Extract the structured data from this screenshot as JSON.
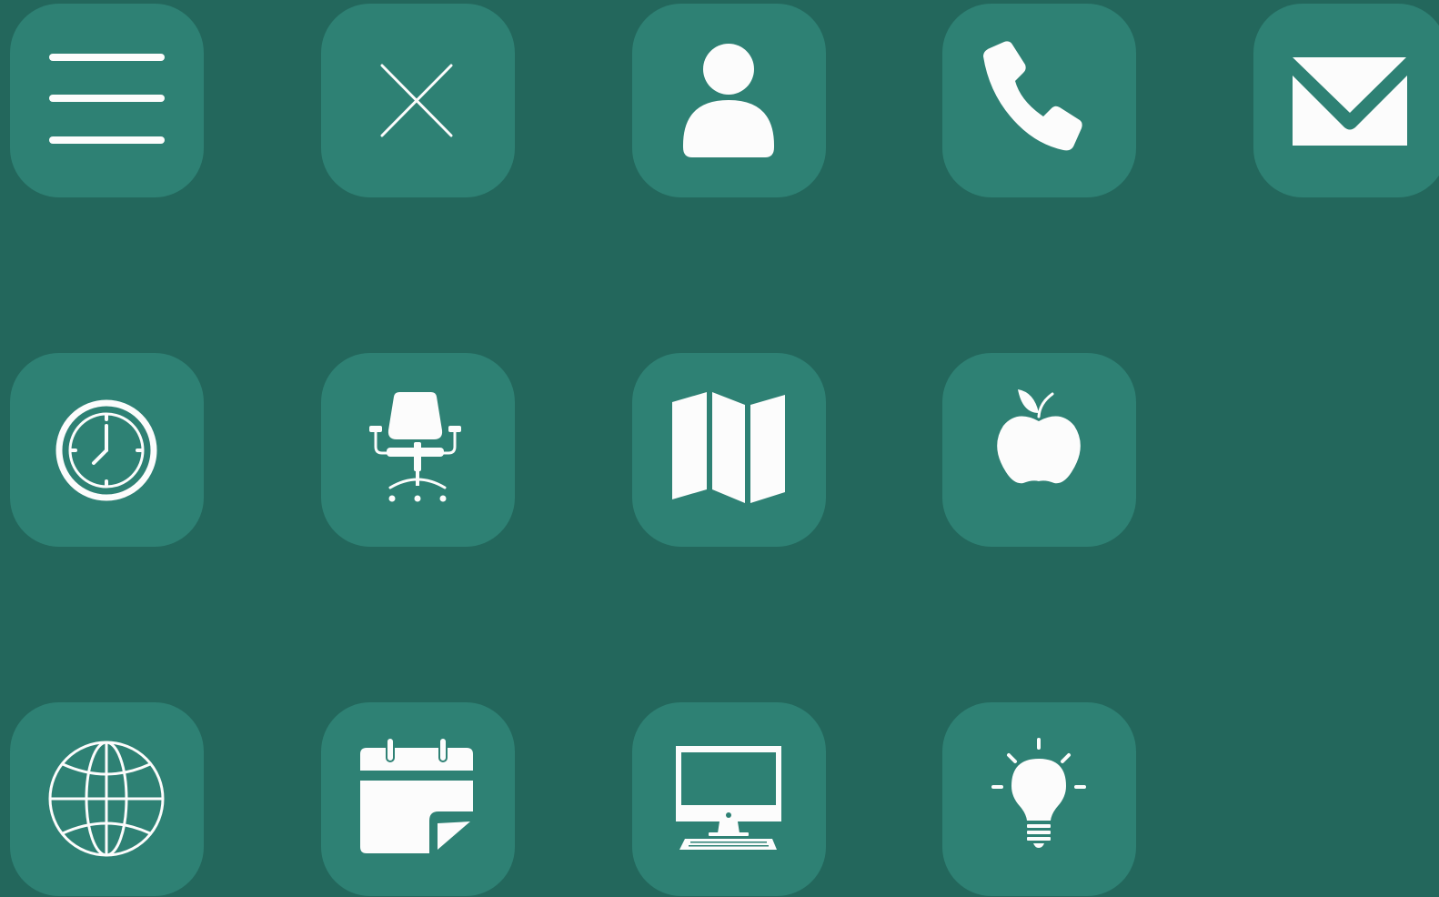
{
  "theme": {
    "background": "#23675c",
    "tile": "#2e8174",
    "icon": "#fcfcfc"
  },
  "icons": [
    {
      "row": 1,
      "col": 1,
      "icon": "menu-icon"
    },
    {
      "row": 1,
      "col": 2,
      "icon": "close-icon"
    },
    {
      "row": 1,
      "col": 3,
      "icon": "user-icon"
    },
    {
      "row": 1,
      "col": 4,
      "icon": "phone-icon"
    },
    {
      "row": 1,
      "col": 5,
      "icon": "mail-icon"
    },
    {
      "row": 2,
      "col": 1,
      "icon": "clock-icon"
    },
    {
      "row": 2,
      "col": 2,
      "icon": "office-chair-icon"
    },
    {
      "row": 2,
      "col": 3,
      "icon": "map-icon"
    },
    {
      "row": 2,
      "col": 4,
      "icon": "apple-icon"
    },
    {
      "row": 3,
      "col": 1,
      "icon": "globe-icon"
    },
    {
      "row": 3,
      "col": 2,
      "icon": "calendar-icon"
    },
    {
      "row": 3,
      "col": 3,
      "icon": "desktop-computer-icon"
    },
    {
      "row": 3,
      "col": 4,
      "icon": "lightbulb-icon"
    }
  ]
}
